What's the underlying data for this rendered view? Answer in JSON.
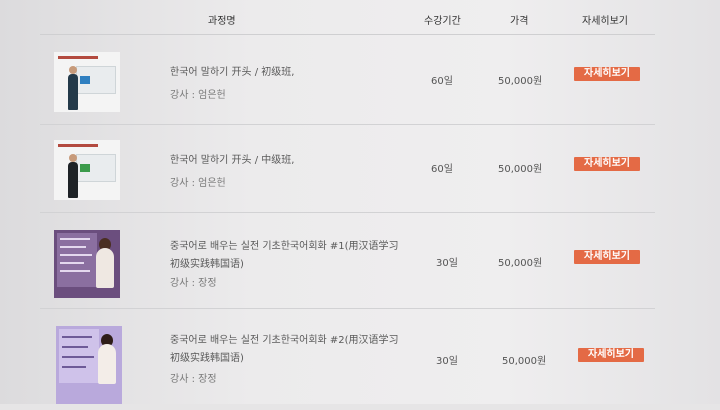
{
  "header": {
    "course": "과정명",
    "period": "수강기간",
    "price": "가격",
    "detail": "자세히보기"
  },
  "courses": [
    {
      "title": "한국어 말하기 开头 / 初级班,",
      "teacher": "강사 : 엄은헌",
      "period": "60일",
      "price": "50,000원",
      "button": "자세히보기"
    },
    {
      "title": "한국어 말하기 开头 / 中级班,",
      "teacher": "강사 : 엄은헌",
      "period": "60일",
      "price": "50,000원",
      "button": "자세히보기"
    },
    {
      "title": "중국어로 배우는 실전 기초한국어회화 #1(用汉语学习初级实践韩国语)",
      "teacher": "강사 : 장정",
      "period": "30일",
      "price": "50,000원",
      "button": "자세히보기"
    },
    {
      "title": "중국어로 배우는 실전 기초한국어회화 #2(用汉语学习初级实践韩国语)",
      "teacher": "강사 : 장정",
      "period": "30일",
      "price": "50,000원",
      "button": "자세히보기"
    }
  ],
  "colors": {
    "button": "#e46a45",
    "background": "#e6e5e6"
  }
}
